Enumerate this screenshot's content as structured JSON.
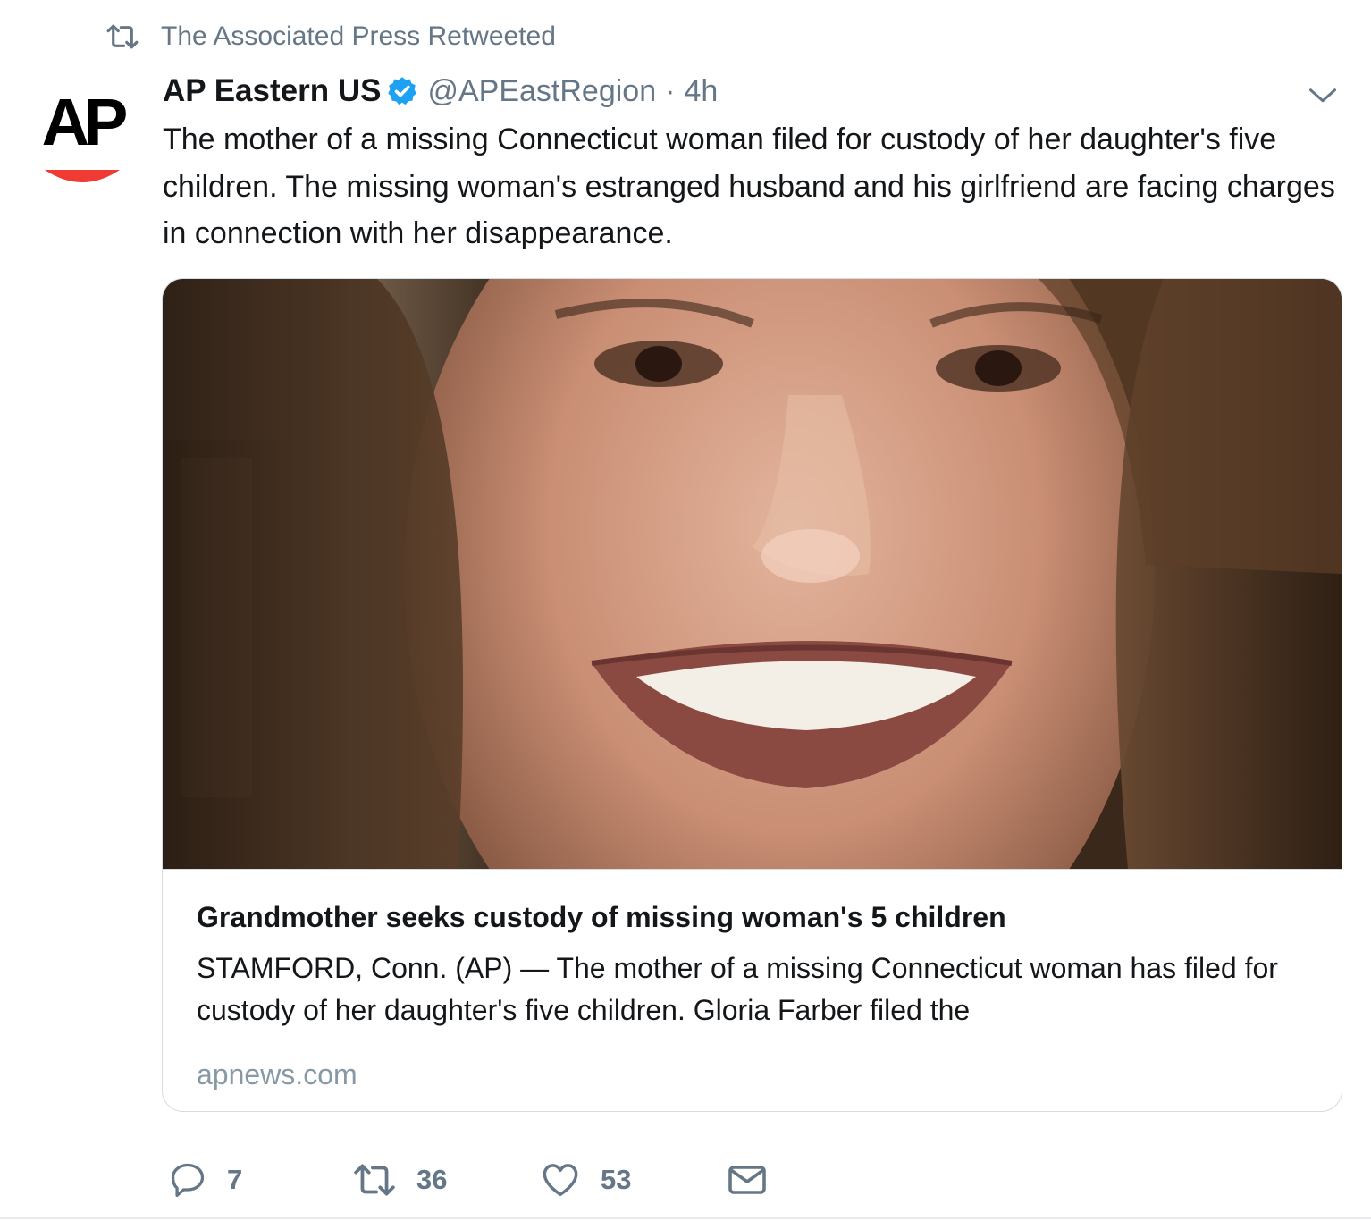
{
  "retweet_context": {
    "icon": "retweet-icon",
    "label": "The Associated Press Retweeted"
  },
  "author": {
    "avatar_text": "AP",
    "display_name": "AP Eastern US",
    "verified": true,
    "handle": "@APEastRegion",
    "separator": "·",
    "timestamp": "4h"
  },
  "tweet": {
    "text": "The mother of a missing Connecticut woman filed for custody of her daughter's five children. The missing woman's estranged husband and his girlfriend are facing charges in connection with her disappearance."
  },
  "card": {
    "title": "Grandmother seeks custody of missing woman's 5 children",
    "description": "STAMFORD, Conn. (AP) — The mother of a missing Connecticut woman has filed for custody of her daughter's five children. Gloria Farber filed the",
    "domain": "apnews.com"
  },
  "actions": {
    "reply_count": "7",
    "retweet_count": "36",
    "like_count": "53"
  },
  "colors": {
    "text_primary": "#14171a",
    "text_secondary": "#657786",
    "verified_blue": "#1da1f2",
    "ap_red": "#ef3b33",
    "border": "#d6dde3"
  }
}
